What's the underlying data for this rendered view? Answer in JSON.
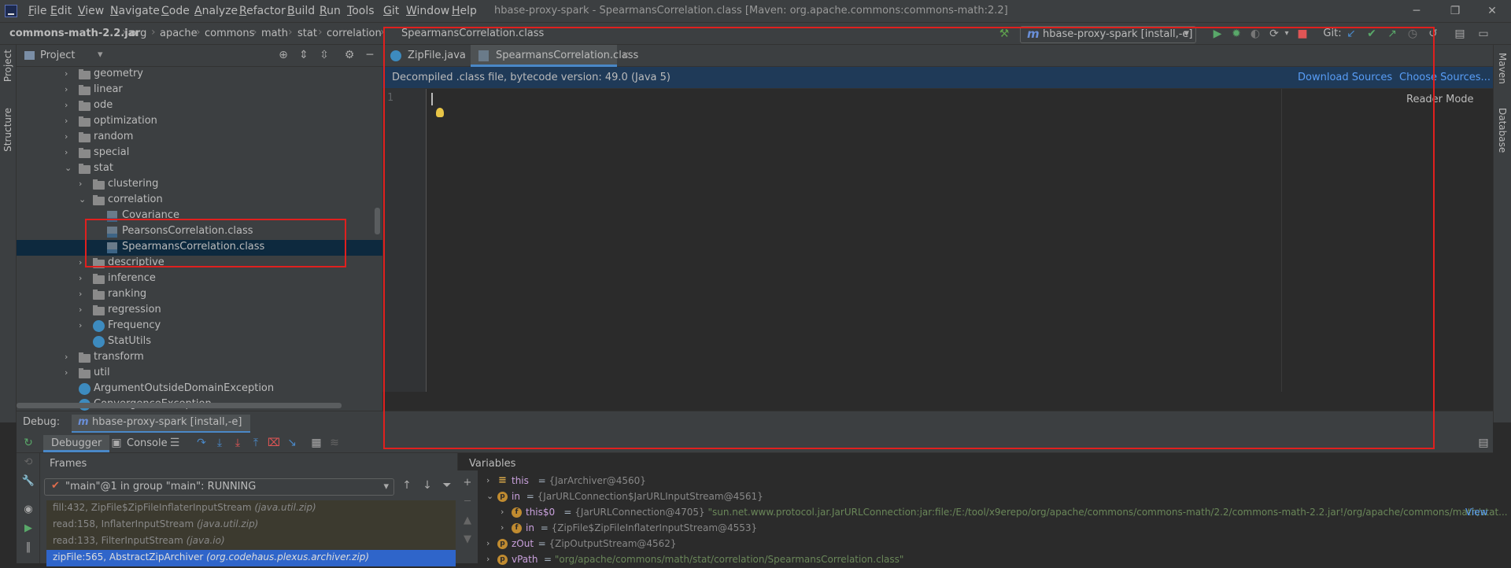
{
  "window": {
    "title": "hbase-proxy-spark - SpearmansCorrelation.class [Maven: org.apache.commons:commons-math:2.2]",
    "minimize": "─",
    "restore": "❐",
    "close": "✕"
  },
  "menu": [
    "File",
    "Edit",
    "View",
    "Navigate",
    "Code",
    "Analyze",
    "Refactor",
    "Build",
    "Run",
    "Tools",
    "Git",
    "Window",
    "Help"
  ],
  "breadcrumb": [
    "commons-math-2.2.jar",
    "org",
    "apache",
    "commons",
    "math",
    "stat",
    "correlation",
    "SpearmansCorrelation.class"
  ],
  "toolbar": {
    "run_config": "hbase-proxy-spark [install,-e]",
    "maven_glyph": "m",
    "git_label": "Git:"
  },
  "side_tabs": {
    "left": [
      "Project",
      "Structure"
    ],
    "right": [
      "Maven",
      "Database"
    ]
  },
  "project": {
    "header_label": "Project",
    "tree": [
      {
        "label": "geometry",
        "type": "folder",
        "level": 1,
        "expanded": false
      },
      {
        "label": "linear",
        "type": "folder",
        "level": 1,
        "expanded": false
      },
      {
        "label": "ode",
        "type": "folder",
        "level": 1,
        "expanded": false
      },
      {
        "label": "optimization",
        "type": "folder",
        "level": 1,
        "expanded": false
      },
      {
        "label": "random",
        "type": "folder",
        "level": 1,
        "expanded": false
      },
      {
        "label": "special",
        "type": "folder",
        "level": 1,
        "expanded": false
      },
      {
        "label": "stat",
        "type": "folder",
        "level": 1,
        "expanded": true
      },
      {
        "label": "clustering",
        "type": "folder",
        "level": 2,
        "expanded": false
      },
      {
        "label": "correlation",
        "type": "folder",
        "level": 2,
        "expanded": true
      },
      {
        "label": "Covariance",
        "type": "classfile",
        "level": 3
      },
      {
        "label": "PearsonsCorrelation.class",
        "type": "classfile",
        "level": 3
      },
      {
        "label": "SpearmansCorrelation.class",
        "type": "classfile",
        "level": 3,
        "selected": true
      },
      {
        "label": "descriptive",
        "type": "folder",
        "level": 2,
        "expanded": false
      },
      {
        "label": "inference",
        "type": "folder",
        "level": 2,
        "expanded": false
      },
      {
        "label": "ranking",
        "type": "folder",
        "level": 2,
        "expanded": false
      },
      {
        "label": "regression",
        "type": "folder",
        "level": 2,
        "expanded": false
      },
      {
        "label": "Frequency",
        "type": "class",
        "level": 2,
        "expanded": false
      },
      {
        "label": "StatUtils",
        "type": "class",
        "level": 2
      },
      {
        "label": "transform",
        "type": "folder",
        "level": 1,
        "expanded": false
      },
      {
        "label": "util",
        "type": "folder",
        "level": 1,
        "expanded": false
      },
      {
        "label": "ArgumentOutsideDomainException",
        "type": "class",
        "level": 1
      },
      {
        "label": "ConvergenceException",
        "type": "class",
        "level": 1
      }
    ]
  },
  "editor": {
    "tabs": [
      {
        "label": "ZipFile.java",
        "active": false
      },
      {
        "label": "SpearmansCorrelation.class",
        "active": true
      }
    ],
    "info_message": "Decompiled .class file, bytecode version: 49.0 (Java 5)",
    "download_sources": "Download Sources",
    "choose_sources": "Choose Sources...",
    "line_number": "1",
    "reader_mode": "Reader Mode"
  },
  "debug": {
    "label": "Debug:",
    "config": "hbase-proxy-spark [install,-e]",
    "tabs": [
      "Debugger",
      "Console"
    ],
    "frames_header": "Frames",
    "thread": "\"main\"@1 in group \"main\": RUNNING",
    "frames": [
      {
        "method": "fill:432, ZipFile$ZipFileInflaterInputStream",
        "pkg": "(java.util.zip)"
      },
      {
        "method": "read:158, InflaterInputStream",
        "pkg": "(java.util.zip)"
      },
      {
        "method": "read:133, FilterInputStream",
        "pkg": "(java.io)"
      },
      {
        "method": "zipFile:565, AbstractZipArchiver",
        "pkg": "(org.codehaus.plexus.archiver.zip)",
        "selected": true
      }
    ],
    "variables_header": "Variables",
    "variables": [
      {
        "indent": 0,
        "badge": "≡",
        "name": "this",
        "value": "{JarArchiver@4560}"
      },
      {
        "indent": 0,
        "badge": "p",
        "name": "in",
        "value": "{JarURLConnection$JarURLInputStream@4561}",
        "expanded": true
      },
      {
        "indent": 1,
        "badge": "f",
        "name": "this$0",
        "value": "{JarURLConnection@4705}",
        "str": "\"sun.net.www.protocol.jar.JarURLConnection:jar:file:/E:/tool/x9erepo/org/apache/commons/commons-math/2.2/commons-math-2.2.jar!/org/apache/commons/math/stat...",
        "link": "View"
      },
      {
        "indent": 1,
        "badge": "f",
        "name": "in",
        "value": "{ZipFile$ZipFileInflaterInputStream@4553}"
      },
      {
        "indent": 0,
        "badge": "p",
        "name": "zOut",
        "value": "{ZipOutputStream@4562}"
      },
      {
        "indent": 0,
        "badge": "p",
        "name": "vPath",
        "value": "",
        "str": "\"org/apache/commons/math/stat/correlation/SpearmansCorrelation.class\""
      }
    ]
  },
  "colors": {
    "bg": "#2b2b2b",
    "panel": "#3c3f41",
    "selection": "#0d293e",
    "accent": "#4a88c7",
    "link": "#589df6",
    "highlight_box": "#e0201e"
  }
}
